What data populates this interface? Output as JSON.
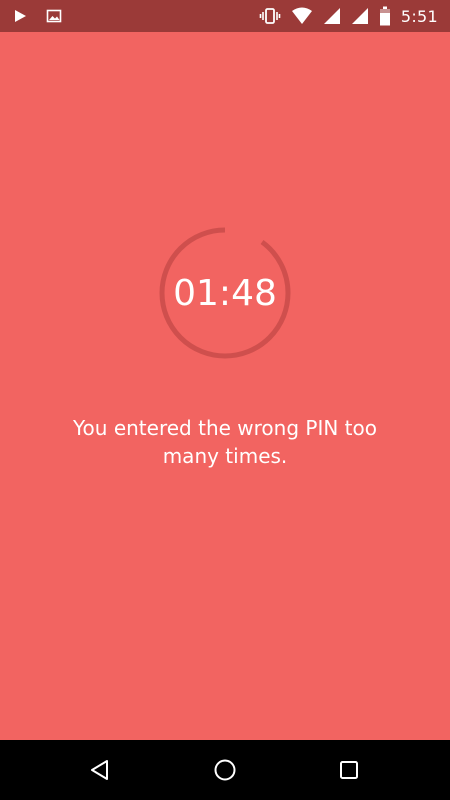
{
  "status_bar": {
    "time": "5:51",
    "icons": [
      "play-icon",
      "image-icon",
      "vibrate-icon",
      "wifi-icon",
      "signal-icon",
      "signal-icon",
      "battery-icon"
    ]
  },
  "lockout": {
    "countdown": "01:48",
    "remaining_fraction": 0.9,
    "message": "You entered the wrong PIN too many times."
  },
  "colors": {
    "background": "#f26461",
    "status_bar": "#9b3a38",
    "ring": "#cf4f4d",
    "text": "#ffffff"
  },
  "nav_bar": {
    "buttons": [
      "back-icon",
      "home-icon",
      "recent-apps-icon"
    ]
  }
}
